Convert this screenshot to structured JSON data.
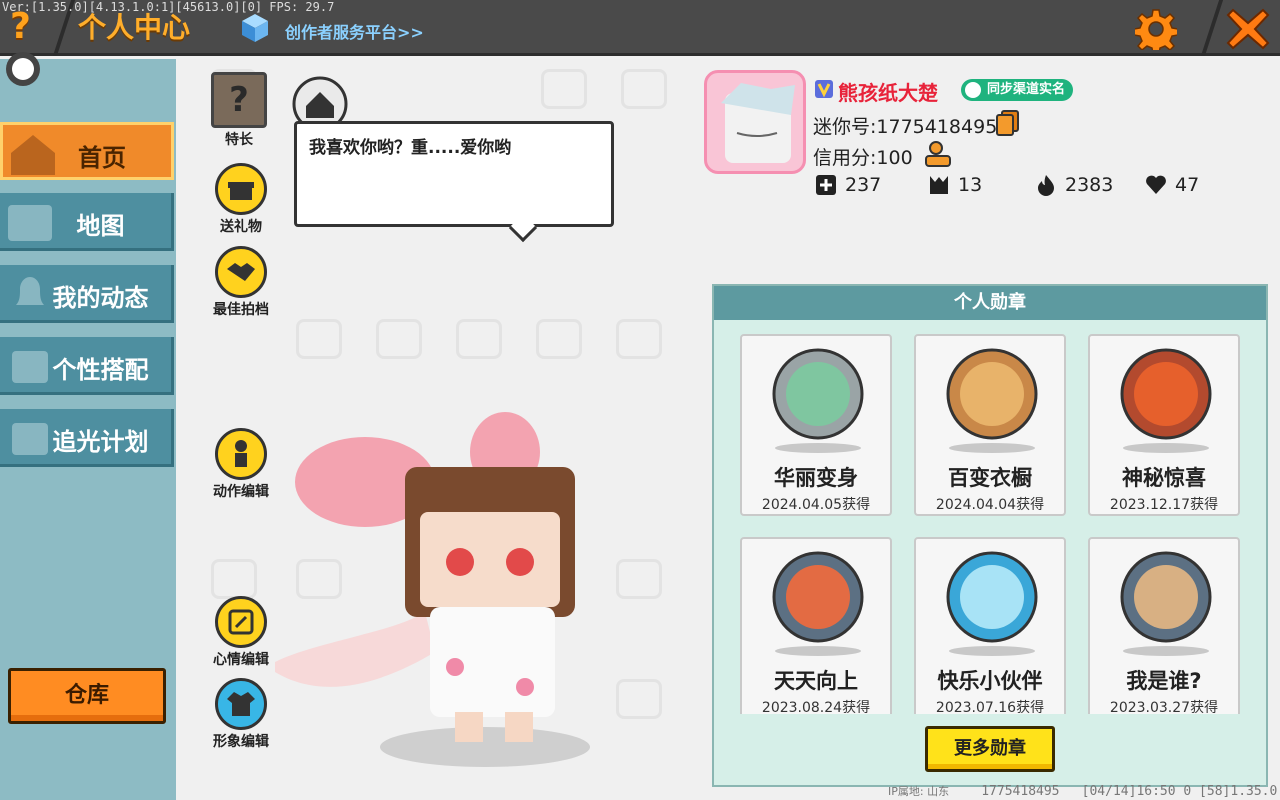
{
  "topbar": {
    "version_info": "Ver:[1.35.0][4.13.1.0:1][45613.0][0] FPS: 29.7",
    "help_symbol": "?",
    "title": "个人中心",
    "creator_link": "创作者服务平台>>"
  },
  "sidebar": {
    "items": [
      {
        "label": "首页",
        "icon": "home-icon",
        "active": true
      },
      {
        "label": "地图",
        "icon": "map-icon",
        "active": false
      },
      {
        "label": "我的动态",
        "icon": "bell-icon",
        "active": false
      },
      {
        "label": "个性搭配",
        "icon": "outfit-icon",
        "active": false
      },
      {
        "label": "追光计划",
        "icon": "light-plan-icon",
        "active": false
      }
    ],
    "storage_label": "仓库"
  },
  "actions": {
    "specialty": "特长",
    "specialty_symbol": "?",
    "gift": "送礼物",
    "best_partner": "最佳拍档",
    "action_edit": "动作编辑",
    "mood_edit": "心情编辑",
    "image_edit": "形象编辑"
  },
  "bubble": {
    "text": "我喜欢你哟？重.....爱你哟"
  },
  "profile": {
    "nickname": "熊孩纸大楚",
    "realname_badge": "同步渠道实名",
    "mini_id": "迷你号:1775418495",
    "credit": "信用分:100",
    "stats": [
      {
        "icon": "plus-icon",
        "value": "237"
      },
      {
        "icon": "fans-icon",
        "value": "13"
      },
      {
        "icon": "fire-icon",
        "value": "2383"
      },
      {
        "icon": "heart-icon",
        "value": "47"
      }
    ]
  },
  "badges": {
    "title": "个人勋章",
    "items": [
      {
        "name": "华丽变身",
        "date": "2024.04.05获得",
        "color": "#9aa4a6",
        "inner": "#7fc6a0"
      },
      {
        "name": "百变衣橱",
        "date": "2024.04.04获得",
        "color": "#c98848",
        "inner": "#e8b36a"
      },
      {
        "name": "神秘惊喜",
        "date": "2023.12.17获得",
        "color": "#b34a2e",
        "inner": "#e6602c"
      },
      {
        "name": "天天向上",
        "date": "2023.08.24获得",
        "color": "#5c7083",
        "inner": "#e36b43"
      },
      {
        "name": "快乐小伙伴",
        "date": "2023.07.16获得",
        "color": "#3aa7d8",
        "inner": "#a8e3f6"
      },
      {
        "name": "我是谁?",
        "date": "2023.03.27获得",
        "color": "#5c7083",
        "inner": "#d8b083"
      }
    ],
    "more_label": "更多勋章"
  },
  "footer": {
    "ip_location": "IP属地: 山东",
    "id": "1775418495",
    "time_info": "[04/14]16:50 0  [58]1.35.0"
  },
  "colors": {
    "accent_orange": "#f08a2a",
    "nav_teal": "#4e8fa0",
    "badge_header": "#5d9aa0",
    "nickname_red": "#e8233a",
    "more_button_yellow": "#ffe21a"
  }
}
